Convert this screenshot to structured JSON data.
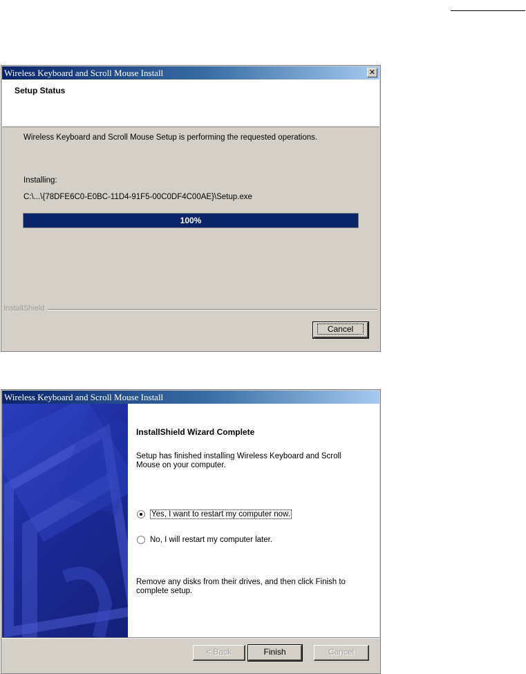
{
  "setup_status_dialog": {
    "title": "Wireless Keyboard and Scroll Mouse Install",
    "close_glyph": "✕",
    "header": "Setup Status",
    "message": "Wireless Keyboard and Scroll Mouse Setup is performing the requested operations.",
    "installing_label": "Installing:",
    "installing_path": "C:\\...\\{78DFE6C0-E0BC-11D4-91F5-00C0DF4C00AE}\\Setup.exe",
    "progress": 1.0,
    "progress_text": "100%",
    "brand": "InstallShield",
    "cancel_label": "Cancel"
  },
  "complete_dialog": {
    "title": "Wireless Keyboard and Scroll Mouse Install",
    "heading": "InstallShield Wizard Complete",
    "description": "Setup has finished installing Wireless Keyboard and Scroll Mouse on your computer.",
    "options": [
      {
        "label": "Yes, I want to restart my computer now.",
        "selected": true
      },
      {
        "label": "No, I will restart my computer later.",
        "selected": false
      }
    ],
    "remove_disks": "Remove any disks from their drives, and then click Finish to complete setup.",
    "back_label": "< Back",
    "finish_label": "Finish",
    "cancel_label": "Cancel"
  },
  "colors": {
    "dialog_face": "#d4d0c8",
    "progress_fill": "#0a246a",
    "side_panel": "#1c2a9a"
  }
}
